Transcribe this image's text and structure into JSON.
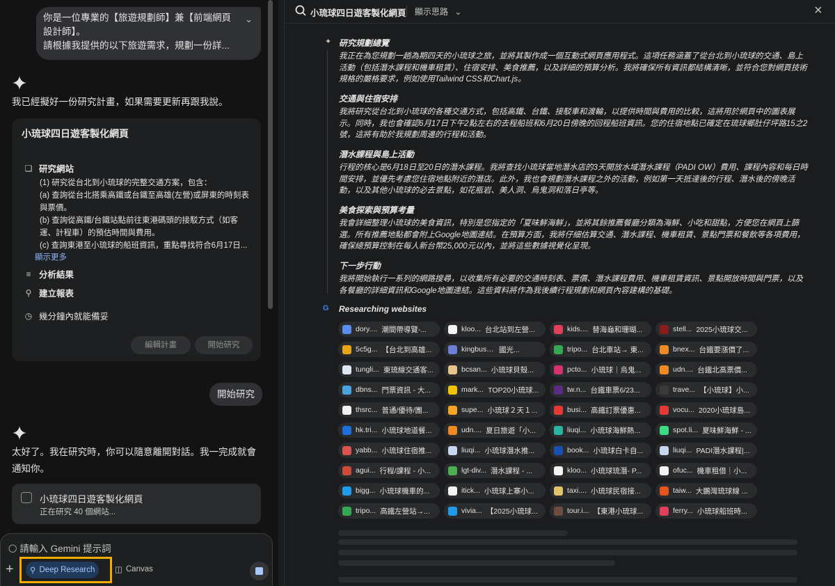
{
  "left": {
    "user_message": {
      "lines": [
        "你是一位專業的【旅遊規劃師】兼【前端網頁",
        "設計師】。",
        "請根據我提供的以下旅遊需求，規劃一份詳..."
      ]
    },
    "reply1": "我已經擬好一份研究計畫，如果需要更新再跟我說。",
    "plan": {
      "title": "小琉球四日遊客製化網頁",
      "step1_label": "研究網站",
      "step1_lines": [
        "(1) 研究從台北到小琉球的完整交通方案，包含：",
        "(a) 查詢從台北搭乘高鐵或台鐵至高雄(左營)或屏東的時刻表",
        "與票價。",
        "(b) 查詢從高鐵/台鐵站點前往東港碼頭的接駁方式（如客",
        "運、計程車）的預估時間與費用。",
        "(c) 查詢東港至小琉球的船班資訊，重點尋找符合6月17日..."
      ],
      "show_more": "顯示更多",
      "step2_label": "分析結果",
      "step3_label": "建立報表",
      "eta_label": "幾分鐘內就能備妥",
      "edit_button": "編輯計畫",
      "start_button": "開始研究"
    },
    "user_pill": "開始研究",
    "reply2_lines": [
      "太好了。我在研究時，你可以隨意離開對話。我一完成就會",
      "通知你。"
    ],
    "status_card": {
      "title": "小琉球四日遊客製化網頁",
      "subtitle": "正在研究 40 個網站..."
    },
    "input": {
      "placeholder": "請輸入 Gemini 提示詞",
      "deep_research": "Deep Research",
      "canvas": "Canvas"
    }
  },
  "right": {
    "title": "小琉球四日遊客製化網頁",
    "show_thinking": "顯示思路",
    "sections": [
      {
        "heading": "研究規劃總覽",
        "body": "我正在為您規劃一趟為期四天的小琉球之旅，並將其製作成一個互動式網頁應用程式。這項任務涵蓋了從台北到小琉球的交通、島上活動（包括潛水課程和機車租賃）、住宿安排、美食推薦，以及詳細的預算分析。我將確保所有資訊都結構清晰，並符合您對網頁技術規格的嚴格要求，例如使用Tailwind CSS和Chart.js。"
      },
      {
        "heading": "交通與住宿安排",
        "body": "我將研究從台北到小琉球的各種交通方式，包括高鐵、台鐵、接駁車和渡輪，以提供時間與費用的比較，這將用於網頁中的圖表展示。同時，我也會確認6月17日下午2點左右的去程船班和6月20日傍晚的回程船班資訊。您的住宿地點已確定在琉球鄉肚仔坪路15之2號，這將有助於我規劃周邊的行程和活動。"
      },
      {
        "heading": "潛水課程與島上活動",
        "body": "行程的核心是6月18日至20日的潛水課程。我將查找小琉球當地潛水店的3天開放水域潛水課程（PADI OW）費用、課程內容和每日時間安排，並優先考慮您住宿地點附近的潛店。此外，我也會規劃潛水課程之外的活動，例如第一天抵達後的行程、潛水後的傍晚活動，以及其他小琉球的必去景點，如花瓶岩、美人洞、烏鬼洞和落日亭等。"
      },
      {
        "heading": "美食探索與預算考量",
        "body": "我會詳細整理小琉球的美食資訊，特別是您指定的「夏味鮮海鮮」，並將其餘推薦餐廳分類為海鮮、小吃和甜點，方便您在網頁上篩選。所有推薦地點都會附上Google地圖連結。在預算方面，我將仔細估算交通、潛水課程、機車租賃、景點門票和餐飲等各項費用，確保總預算控制在每人新台幣25,000元以內，並將這些數據視覺化呈現。"
      },
      {
        "heading": "下一步行動",
        "body": "我將開始執行一系列的網路搜尋，以收集所有必要的交通時刻表、票價、潛水課程費用、機車租賃資訊、景點開放時間與門票，以及各餐廳的詳細資訊和Google地圖連結。這些資料將作為我後續行程規劃和網頁內容建構的基礎。"
      }
    ],
    "researching_label": "Researching websites",
    "sites": [
      {
        "domain": "dory....",
        "title": "潮間帶導覽-...",
        "color": "#5b8def"
      },
      {
        "domain": "kloo...",
        "title": "台北站到左營...",
        "color": "#f4f4f4"
      },
      {
        "domain": "kids....",
        "title": "替海龜和珊瑚...",
        "color": "#e2405a"
      },
      {
        "domain": "stell...",
        "title": "2025小琉球交...",
        "color": "#8a1c1c"
      },
      {
        "domain": "5c5g...",
        "title": "【台北到高雄...",
        "color": "#e8a317"
      },
      {
        "domain": "kingbus.com...",
        "title": "國光...",
        "color": "#6b7fd7"
      },
      {
        "domain": "tripo...",
        "title": "台北車站→ 東...",
        "color": "#34a853"
      },
      {
        "domain": "bnex...",
        "title": "台鐵要漲價了...",
        "color": "#f08a24"
      },
      {
        "domain": "tungli...",
        "title": "東琉線交通客...",
        "color": "#dfe7f5"
      },
      {
        "domain": "bcsan...",
        "title": "小琉球貝殼...",
        "color": "#e8c48a"
      },
      {
        "domain": "pcto...",
        "title": "小琉球｜烏鬼...",
        "color": "#d6336c"
      },
      {
        "domain": "udn....",
        "title": "台鐵北高票價...",
        "color": "#f08a24"
      },
      {
        "domain": "dbns...",
        "title": "門票資訊 - 大...",
        "color": "#4aa3df"
      },
      {
        "domain": "mark...",
        "title": "TOP20小琉球...",
        "color": "#f2c400"
      },
      {
        "domain": "tw.n...",
        "title": "台鐵車票6/23...",
        "color": "#5a2d82"
      },
      {
        "domain": "trave...",
        "title": "【小琉球】小...",
        "color": "#3a3a3a"
      },
      {
        "domain": "thsrc...",
        "title": "普通/優待/團...",
        "color": "#f0f0f0"
      },
      {
        "domain": "supe...",
        "title": "小琉球２天１...",
        "color": "#f5a623"
      },
      {
        "domain": "busi...",
        "title": "高鐵訂票優惠...",
        "color": "#e53935"
      },
      {
        "domain": "vocu...",
        "title": "2020小琉球島...",
        "color": "#e53935"
      },
      {
        "domain": "hk.tri...",
        "title": "小琉球地道餐...",
        "color": "#1e6fd9"
      },
      {
        "domain": "udn....",
        "title": "夏日旅遊「小...",
        "color": "#f08a24"
      },
      {
        "domain": "liuqi...",
        "title": "小琉球海鮮熱...",
        "color": "#2bb3a3"
      },
      {
        "domain": "spot.li...",
        "title": "夏味鮮海鮮 - ...",
        "color": "#3ddc84"
      },
      {
        "domain": "yabb...",
        "title": "小琉球住宿推...",
        "color": "#d9534f"
      },
      {
        "domain": "liuqi...",
        "title": "小琉球潛水推...",
        "color": "#c9d6f0"
      },
      {
        "domain": "book...",
        "title": "小琉球白卡自...",
        "color": "#1a4fb4"
      },
      {
        "domain": "liuqi...",
        "title": "PADI潛水課程|...",
        "color": "#c9d6f0"
      },
      {
        "domain": "agui...",
        "title": "行程/課程 - 小...",
        "color": "#d04a3a"
      },
      {
        "domain": "lgt-div...",
        "title": "潛水課程 - ...",
        "color": "#4caf50"
      },
      {
        "domain": "kloo...",
        "title": "小琉球琉潛- P...",
        "color": "#f4f4f4"
      },
      {
        "domain": "ofuc...",
        "title": "機車租借｜小...",
        "color": "#f4f4f4"
      },
      {
        "domain": "bigg...",
        "title": "小琉球機車的...",
        "color": "#1e9be9"
      },
      {
        "domain": "itick...",
        "title": "小琉球上寨小...",
        "color": "#f4f4f4"
      },
      {
        "domain": "taxi....",
        "title": "小琉球民宿接...",
        "color": "#e0c36a"
      },
      {
        "domain": "taiw...",
        "title": "大鵬灣琉球線 ...",
        "color": "#e8541e"
      },
      {
        "domain": "tripo...",
        "title": "高鐵左營站→...",
        "color": "#34a853"
      },
      {
        "domain": "vivia...",
        "title": "【2025小琉球...",
        "color": "#1e9be9"
      },
      {
        "domain": "tour.i...",
        "title": "【東港小琉球...",
        "color": "#6d4c41"
      },
      {
        "domain": "ferry...",
        "title": "小琉球船班時...",
        "color": "#e2405a"
      }
    ]
  },
  "colors": {
    "accent": "#a8c7fa",
    "highlight_border": "#f5ab00",
    "link": "#8ab4f8"
  }
}
